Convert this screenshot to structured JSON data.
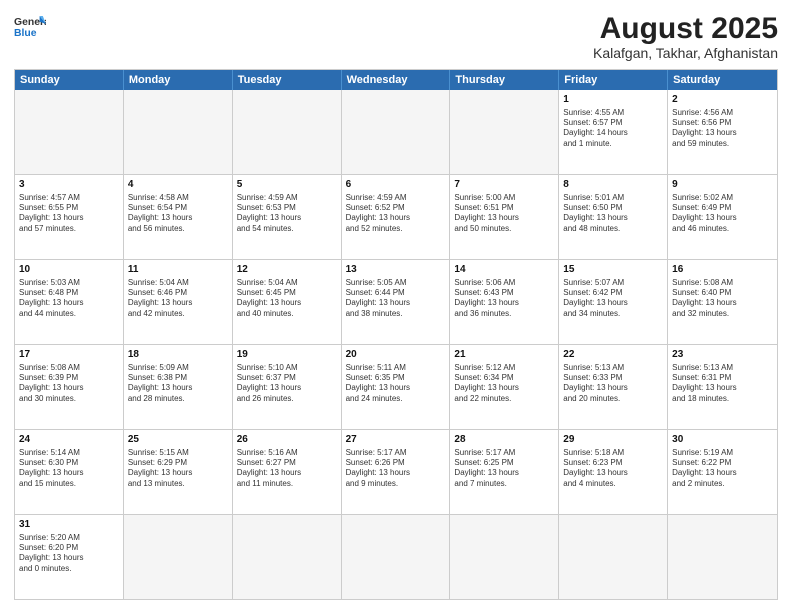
{
  "logo": {
    "line1": "General",
    "line2": "Blue"
  },
  "title": "August 2025",
  "subtitle": "Kalafgan, Takhar, Afghanistan",
  "weekdays": [
    "Sunday",
    "Monday",
    "Tuesday",
    "Wednesday",
    "Thursday",
    "Friday",
    "Saturday"
  ],
  "rows": [
    {
      "cells": [
        {
          "day": "",
          "info": "",
          "empty": true
        },
        {
          "day": "",
          "info": "",
          "empty": true
        },
        {
          "day": "",
          "info": "",
          "empty": true
        },
        {
          "day": "",
          "info": "",
          "empty": true
        },
        {
          "day": "",
          "info": "",
          "empty": true
        },
        {
          "day": "1",
          "info": "Sunrise: 4:55 AM\nSunset: 6:57 PM\nDaylight: 14 hours\nand 1 minute."
        },
        {
          "day": "2",
          "info": "Sunrise: 4:56 AM\nSunset: 6:56 PM\nDaylight: 13 hours\nand 59 minutes."
        }
      ]
    },
    {
      "cells": [
        {
          "day": "3",
          "info": "Sunrise: 4:57 AM\nSunset: 6:55 PM\nDaylight: 13 hours\nand 57 minutes."
        },
        {
          "day": "4",
          "info": "Sunrise: 4:58 AM\nSunset: 6:54 PM\nDaylight: 13 hours\nand 56 minutes."
        },
        {
          "day": "5",
          "info": "Sunrise: 4:59 AM\nSunset: 6:53 PM\nDaylight: 13 hours\nand 54 minutes."
        },
        {
          "day": "6",
          "info": "Sunrise: 4:59 AM\nSunset: 6:52 PM\nDaylight: 13 hours\nand 52 minutes."
        },
        {
          "day": "7",
          "info": "Sunrise: 5:00 AM\nSunset: 6:51 PM\nDaylight: 13 hours\nand 50 minutes."
        },
        {
          "day": "8",
          "info": "Sunrise: 5:01 AM\nSunset: 6:50 PM\nDaylight: 13 hours\nand 48 minutes."
        },
        {
          "day": "9",
          "info": "Sunrise: 5:02 AM\nSunset: 6:49 PM\nDaylight: 13 hours\nand 46 minutes."
        }
      ]
    },
    {
      "cells": [
        {
          "day": "10",
          "info": "Sunrise: 5:03 AM\nSunset: 6:48 PM\nDaylight: 13 hours\nand 44 minutes."
        },
        {
          "day": "11",
          "info": "Sunrise: 5:04 AM\nSunset: 6:46 PM\nDaylight: 13 hours\nand 42 minutes."
        },
        {
          "day": "12",
          "info": "Sunrise: 5:04 AM\nSunset: 6:45 PM\nDaylight: 13 hours\nand 40 minutes."
        },
        {
          "day": "13",
          "info": "Sunrise: 5:05 AM\nSunset: 6:44 PM\nDaylight: 13 hours\nand 38 minutes."
        },
        {
          "day": "14",
          "info": "Sunrise: 5:06 AM\nSunset: 6:43 PM\nDaylight: 13 hours\nand 36 minutes."
        },
        {
          "day": "15",
          "info": "Sunrise: 5:07 AM\nSunset: 6:42 PM\nDaylight: 13 hours\nand 34 minutes."
        },
        {
          "day": "16",
          "info": "Sunrise: 5:08 AM\nSunset: 6:40 PM\nDaylight: 13 hours\nand 32 minutes."
        }
      ]
    },
    {
      "cells": [
        {
          "day": "17",
          "info": "Sunrise: 5:08 AM\nSunset: 6:39 PM\nDaylight: 13 hours\nand 30 minutes."
        },
        {
          "day": "18",
          "info": "Sunrise: 5:09 AM\nSunset: 6:38 PM\nDaylight: 13 hours\nand 28 minutes."
        },
        {
          "day": "19",
          "info": "Sunrise: 5:10 AM\nSunset: 6:37 PM\nDaylight: 13 hours\nand 26 minutes."
        },
        {
          "day": "20",
          "info": "Sunrise: 5:11 AM\nSunset: 6:35 PM\nDaylight: 13 hours\nand 24 minutes."
        },
        {
          "day": "21",
          "info": "Sunrise: 5:12 AM\nSunset: 6:34 PM\nDaylight: 13 hours\nand 22 minutes."
        },
        {
          "day": "22",
          "info": "Sunrise: 5:13 AM\nSunset: 6:33 PM\nDaylight: 13 hours\nand 20 minutes."
        },
        {
          "day": "23",
          "info": "Sunrise: 5:13 AM\nSunset: 6:31 PM\nDaylight: 13 hours\nand 18 minutes."
        }
      ]
    },
    {
      "cells": [
        {
          "day": "24",
          "info": "Sunrise: 5:14 AM\nSunset: 6:30 PM\nDaylight: 13 hours\nand 15 minutes."
        },
        {
          "day": "25",
          "info": "Sunrise: 5:15 AM\nSunset: 6:29 PM\nDaylight: 13 hours\nand 13 minutes."
        },
        {
          "day": "26",
          "info": "Sunrise: 5:16 AM\nSunset: 6:27 PM\nDaylight: 13 hours\nand 11 minutes."
        },
        {
          "day": "27",
          "info": "Sunrise: 5:17 AM\nSunset: 6:26 PM\nDaylight: 13 hours\nand 9 minutes."
        },
        {
          "day": "28",
          "info": "Sunrise: 5:17 AM\nSunset: 6:25 PM\nDaylight: 13 hours\nand 7 minutes."
        },
        {
          "day": "29",
          "info": "Sunrise: 5:18 AM\nSunset: 6:23 PM\nDaylight: 13 hours\nand 4 minutes."
        },
        {
          "day": "30",
          "info": "Sunrise: 5:19 AM\nSunset: 6:22 PM\nDaylight: 13 hours\nand 2 minutes."
        }
      ]
    },
    {
      "cells": [
        {
          "day": "31",
          "info": "Sunrise: 5:20 AM\nSunset: 6:20 PM\nDaylight: 13 hours\nand 0 minutes."
        },
        {
          "day": "",
          "info": "",
          "empty": true
        },
        {
          "day": "",
          "info": "",
          "empty": true
        },
        {
          "day": "",
          "info": "",
          "empty": true
        },
        {
          "day": "",
          "info": "",
          "empty": true
        },
        {
          "day": "",
          "info": "",
          "empty": true
        },
        {
          "day": "",
          "info": "",
          "empty": true
        }
      ]
    }
  ]
}
